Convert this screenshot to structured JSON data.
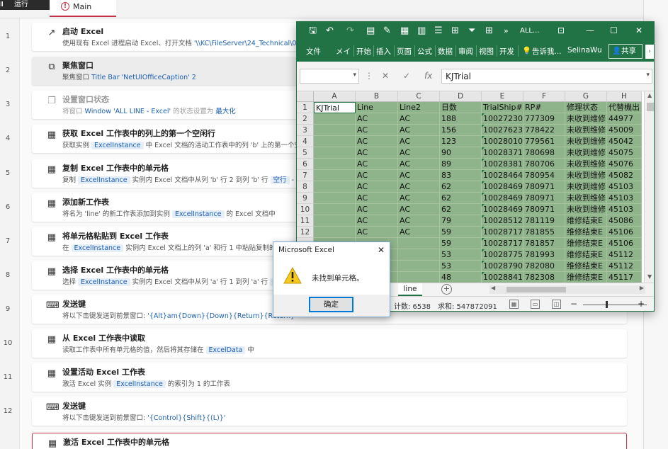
{
  "designer": {
    "run_label": "运行",
    "run_cut": "Ⅱ",
    "main_tab": "Main"
  },
  "steps": [
    {
      "num": "1",
      "title": "启动 Excel",
      "desc": [
        "使用现有 Excel 进程启动 Excel、打开文档 ",
        {
          "lit": "'\\\\KC\\FileServer\\24_Technical\\00_SH"
        }
      ]
    },
    {
      "num": "2",
      "title": "聚焦窗口",
      "desc": [
        "聚焦窗口 ",
        {
          "lit": "Title Bar 'NetUIOfficeCaption' 2"
        }
      ]
    },
    {
      "num": "3",
      "title": "设置窗口状态",
      "desc": [
        "将窗口 ",
        {
          "lit": "Window 'ALL LINE - Excel'"
        },
        " 的状态设置为 ",
        {
          "lit": "最大化"
        }
      ]
    },
    {
      "num": "4",
      "title": "获取 Excel 工作表中的列上的第一个空闲行",
      "desc": [
        "获取实例 ",
        {
          "var": "ExcelInstance"
        },
        " 中 Excel 文档的活动工作表中的列 'b' 上的第一个空"
      ]
    },
    {
      "num": "5",
      "title": "复制 Excel 工作表中的单元格",
      "desc": [
        "复制 ",
        {
          "var": "ExcelInstance"
        },
        " 实例内 Excel 文档中从列 'b' 行 2 到列 'b' 行 ",
        {
          "var": "空行"
        },
        " -"
      ]
    },
    {
      "num": "6",
      "title": "添加新工作表",
      "desc": [
        "将名为 'line' 的新工作表添加到实例 ",
        {
          "var": "ExcelInstance"
        },
        " 的 Excel 文档中"
      ]
    },
    {
      "num": "7",
      "title": "将单元格粘贴到 Excel 工作表",
      "desc": [
        "在 ",
        {
          "var": "ExcelInstance"
        },
        " 实例内 Excel 文档上的列 'a' 和行 1 中粘贴复制的"
      ]
    },
    {
      "num": "8",
      "title": "选择 Excel 工作表中的单元格",
      "desc": [
        "选择 ",
        {
          "var": "ExcelInstance"
        },
        " 实例内 Excel 文档中从列 'a' 行 1 到列 'a' 行 ",
        {
          "var": "空"
        }
      ]
    },
    {
      "num": "9",
      "title": "发送键",
      "desc": [
        "将以下击键发送到前景窗口: ",
        {
          "lit": "'{Alt}am{Down}{Down}{Return}{Return}'"
        }
      ]
    },
    {
      "num": "10",
      "title": "从 Excel 工作表中读取",
      "desc": [
        "读取工作表中所有单元格的值，然后将其存储在 ",
        {
          "var": "ExcelData"
        },
        " 中"
      ]
    },
    {
      "num": "11",
      "title": "设置活动 Excel 工作表",
      "desc": [
        "激活 Excel 实例 ",
        {
          "var": "ExcelInstance"
        },
        " 的索引为 1 的工作表"
      ]
    },
    {
      "num": "12",
      "title": "发送键",
      "desc": [
        "将以下击键发送到前景窗口: ",
        {
          "lit": "'{Control}{Shift}{(L)}'"
        }
      ]
    },
    {
      "num": "",
      "title": "激活 Excel 工作表中的单元格",
      "desc": []
    }
  ],
  "excel": {
    "doc_title": "ALL...",
    "ribbon_tabs": [
      "文件",
      "メイ",
      "开始",
      "插入",
      "页面",
      "公式",
      "数据",
      "审阅",
      "视图",
      "开发"
    ],
    "tell_me": "告诉我...",
    "user": "SelinaWu",
    "share": "共享",
    "formula_value": "KJTrial",
    "columns": [
      "A",
      "B",
      "C",
      "D",
      "E",
      "F",
      "G",
      "H"
    ],
    "rows": [
      {
        "n": "1",
        "cells": [
          "KJTrial",
          "Line",
          "Line2",
          "日数",
          "TrialShip#",
          "RP#",
          "修理状态",
          "代替機出"
        ]
      },
      {
        "n": "2",
        "cells": [
          "",
          "AC",
          "AC",
          "188",
          "100272309",
          "777309",
          "未收到维修",
          "44977"
        ]
      },
      {
        "n": "3",
        "cells": [
          "",
          "AC",
          "AC",
          "156",
          "100276232",
          "778422",
          "未收到维修",
          "45009"
        ]
      },
      {
        "n": "4",
        "cells": [
          "",
          "AC",
          "AC",
          "123",
          "100280107",
          "779561",
          "未收到维修",
          "45042"
        ]
      },
      {
        "n": "5",
        "cells": [
          "",
          "AC",
          "AC",
          "90",
          "100283710",
          "780698",
          "未收到维修",
          "45075"
        ]
      },
      {
        "n": "6",
        "cells": [
          "",
          "AC",
          "AC",
          "89",
          "100283814",
          "780706",
          "未收到维修",
          "45076"
        ]
      },
      {
        "n": "7",
        "cells": [
          "",
          "AC",
          "AC",
          "83",
          "100284645",
          "780954",
          "未收到维修",
          "45082"
        ]
      },
      {
        "n": "8",
        "cells": [
          "",
          "AC",
          "AC",
          "62",
          "100284690",
          "780971",
          "未收到维修",
          "45103"
        ]
      },
      {
        "n": "9",
        "cells": [
          "",
          "AC",
          "AC",
          "62",
          "100284690",
          "780971",
          "未收到维修",
          "45103"
        ]
      },
      {
        "n": "10",
        "cells": [
          "",
          "AC",
          "AC",
          "62",
          "100284690",
          "780971",
          "未收到维修",
          "45103"
        ]
      },
      {
        "n": "11",
        "cells": [
          "",
          "AC",
          "AC",
          "79",
          "100285129",
          "781119",
          "维修结束E",
          "45086"
        ]
      },
      {
        "n": "12",
        "cells": [
          "",
          "AC",
          "AC",
          "59",
          "100287170",
          "781855",
          "维修结束E",
          "45106"
        ]
      },
      {
        "n": "",
        "cells": [
          "",
          "",
          "",
          "59",
          "100287170",
          "781857",
          "维修结束E",
          "45106"
        ]
      },
      {
        "n": "",
        "cells": [
          "",
          "",
          "",
          "53",
          "100287757",
          "781993",
          "维修结束E",
          "45112"
        ]
      },
      {
        "n": "",
        "cells": [
          "",
          "",
          "",
          "53",
          "100287900",
          "782080",
          "维修结束E",
          "45112"
        ]
      },
      {
        "n": "",
        "cells": [
          "",
          "",
          "",
          "48",
          "100288414",
          "782308",
          "维修结束E",
          "45117"
        ]
      }
    ],
    "sheet_tab": "line",
    "count_label": "计数: 6538",
    "sum_label": "求和: 547872091"
  },
  "dialog": {
    "title": "Microsoft Excel",
    "message": "未找到单元格。",
    "ok": "确定"
  },
  "colors": {
    "excel_green": "#217346",
    "selection_fill": "#8fb38a",
    "error_border": "#c4314b",
    "variable_blue": "#1a5fb4"
  }
}
